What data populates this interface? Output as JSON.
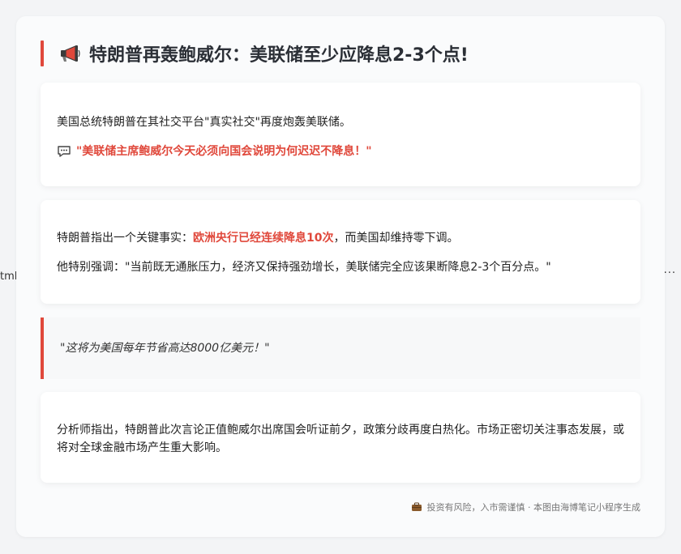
{
  "edges": {
    "left_text": "tml",
    "right_text": "..."
  },
  "title": {
    "icon": "megaphone-icon",
    "text": "特朗普再轰鲍威尔：美联储至少应降息2-3个点!"
  },
  "card1": {
    "line1": "美国总统特朗普在其社交平台\"真实社交\"再度炮轰美联储。",
    "quote_icon": "speech-bubble-icon",
    "quote": "\"美联储主席鲍威尔今天必须向国会说明为何迟迟不降息！\""
  },
  "card2": {
    "line1_prefix": "特朗普指出一个关键事实：",
    "line1_highlight": "欧洲央行已经连续降息10次",
    "line1_suffix": "，而美国却维持零下调。",
    "line2": "他特别强调：\"当前既无通胀压力，经济又保持强劲增长，美联储完全应该果断降息2-3个百分点。\""
  },
  "blockquote": {
    "text": "\"这将为美国每年节省高达8000亿美元！\""
  },
  "card3": {
    "text": "分析师指出，特朗普此次言论正值鲍威尔出席国会听证前夕，政策分歧再度白热化。市场正密切关注事态发展，或将对全球金融市场产生重大影响。"
  },
  "footer": {
    "icon": "briefcase-icon",
    "text": "投资有风险，入市需谨慎 · 本图由海博笔记小程序生成"
  },
  "colors": {
    "accent": "#e0483b",
    "title": "#2b2f36",
    "background": "#f3f4f6",
    "panel": "#fafbfc"
  }
}
